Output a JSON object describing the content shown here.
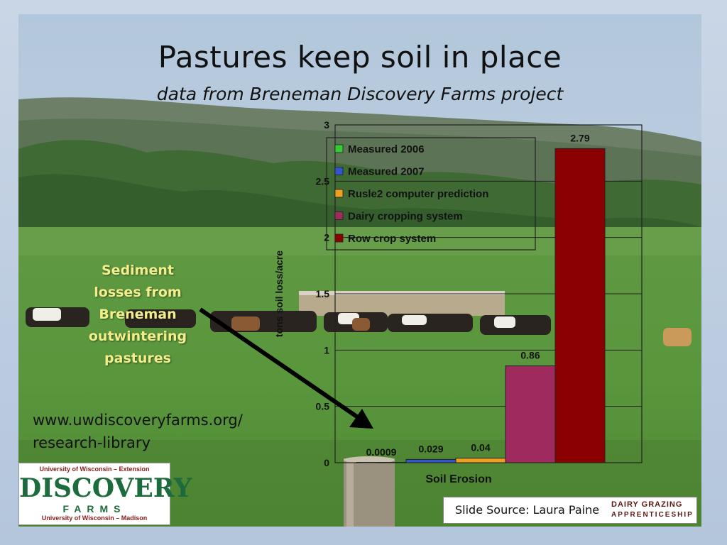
{
  "slide": {
    "title": "Pastures keep soil in place",
    "subtitle": "data from Breneman Discovery Farms project",
    "annotation": [
      "Sediment",
      "losses from",
      "Breneman",
      "outwintering",
      "pastures"
    ],
    "website": [
      "www.uwdiscoveryfarms.org/",
      "research-library"
    ],
    "source": "Slide Source: Laura Paine"
  },
  "logo": {
    "top": "University of Wisconsin – Extension",
    "main": "DISCOVERY",
    "sub": "FARMS",
    "bottom": "University of Wisconsin – Madison"
  },
  "dga_logo": {
    "top": "DAIRY GRAZING",
    "bottom": "APPRENTICESHIP"
  },
  "chart_data": {
    "type": "bar",
    "title": "",
    "xlabel": "Soil Erosion",
    "ylabel": "tons soil loss/acre",
    "ylim": [
      0,
      3
    ],
    "yticks": [
      "0",
      "0.5",
      "1",
      "1.5",
      "2",
      "2.5",
      "3"
    ],
    "grid": true,
    "legend_position": "top-left",
    "series": [
      {
        "name": "Measured 2006",
        "value": 0.0009,
        "label": "0.0009",
        "color": "#33cc33"
      },
      {
        "name": "Measured 2007",
        "value": 0.029,
        "label": "0.029",
        "color": "#3355cc"
      },
      {
        "name": "Rusle2 computer prediction",
        "value": 0.04,
        "label": "0.04",
        "color": "#f0a020"
      },
      {
        "name": "Dairy cropping system",
        "value": 0.86,
        "label": "0.86",
        "color": "#9e2a5e"
      },
      {
        "name": "Row crop system",
        "value": 2.79,
        "label": "2.79",
        "color": "#8b0000"
      }
    ]
  }
}
